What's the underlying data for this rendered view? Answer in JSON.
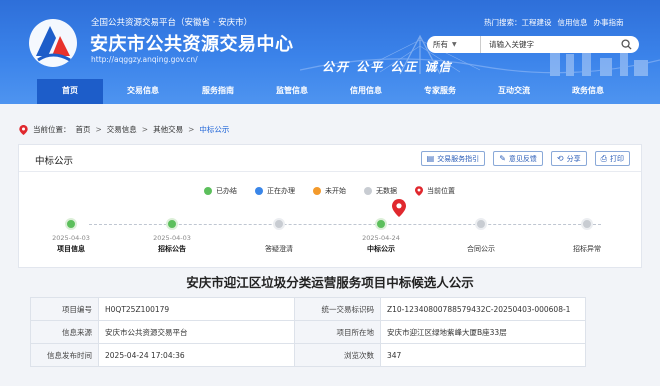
{
  "header": {
    "site_sub": "全国公共资源交易平台（安徽省 · 安庆市）",
    "site_title": "安庆市公共资源交易中心",
    "site_url": "http://aqggzy.anqing.gov.cn/",
    "slogan": "公开  公平  公正  诚信",
    "top_links": [
      "热门搜索：工程建设",
      "信用信息",
      "办事指南"
    ],
    "search": {
      "scope": "所有",
      "placeholder": "请输入关键字"
    }
  },
  "nav": [
    "首页",
    "交易信息",
    "服务指南",
    "监管信息",
    "信用信息",
    "专家服务",
    "互动交流",
    "政务信息"
  ],
  "breadcrumb": {
    "prefix": "当前位置：",
    "items": [
      "首页",
      "交易信息",
      "其他交易"
    ],
    "current": "中标公示",
    "separator": ">"
  },
  "card": {
    "title": "中标公示",
    "tools": [
      "交易服务指引",
      "意见反馈",
      "分享",
      "打印"
    ],
    "legend": [
      {
        "label": "已办结",
        "color": "#5cbf5c"
      },
      {
        "label": "正在办理",
        "color": "#3a86e8"
      },
      {
        "label": "未开始",
        "color": "#f39a2b"
      },
      {
        "label": "无数据",
        "color": "#c8ccd2"
      },
      {
        "label": "当前位置",
        "color": "#e0282e"
      }
    ],
    "steps": [
      {
        "date": "2025-04-03",
        "name": "项目信息",
        "status": "done",
        "bold": true
      },
      {
        "date": "2025-04-03",
        "name": "招标公告",
        "status": "done",
        "bold": true
      },
      {
        "date": "",
        "name": "答疑澄清",
        "status": "none",
        "bold": false
      },
      {
        "date": "2025-04-24",
        "name": "中标公示",
        "status": "current",
        "bold": true
      },
      {
        "date": "",
        "name": "合同公示",
        "status": "none",
        "bold": false
      },
      {
        "date": "",
        "name": "招标异常",
        "status": "none",
        "bold": false
      }
    ]
  },
  "notice_title": "安庆市迎江区垃圾分类运营服务项目中标候选人公示",
  "info": [
    [
      "项目编号",
      "H0QT25Z100179",
      "统一交易标识码",
      "Z10-12340800788579432C-20250403-000608-1"
    ],
    [
      "信息来源",
      "安庆市公共资源交易平台",
      "项目所在地",
      "安庆市迎江区绿地紫峰大厦B座33层"
    ],
    [
      "信息发布时间",
      "2025-04-24 17:04:36",
      "浏览次数",
      "347"
    ]
  ]
}
